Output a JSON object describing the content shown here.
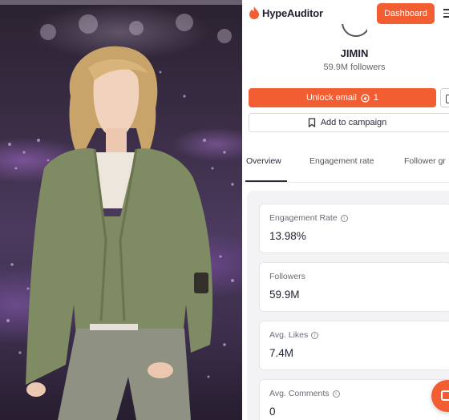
{
  "app": {
    "brand": "HypeAuditor",
    "dashboard_label": "Dashboard"
  },
  "profile": {
    "name": "JIMIN",
    "followers_text": "59.9M followers"
  },
  "actions": {
    "unlock_email_label": "Unlock email",
    "unlock_email_cost": "1",
    "add_to_campaign_label": "Add to campaign"
  },
  "tabs": [
    {
      "label": "Overview",
      "active": true
    },
    {
      "label": "Engagement rate",
      "active": false
    },
    {
      "label": "Follower gr",
      "active": false
    }
  ],
  "metrics": [
    {
      "label": "Engagement Rate",
      "value": "13.98%"
    },
    {
      "label": "Followers",
      "value": "59.9M"
    },
    {
      "label": "Avg. Likes",
      "value": "7.4M"
    },
    {
      "label": "Avg. Comments",
      "value": "0"
    }
  ],
  "colors": {
    "accent": "#f25d32",
    "text_dark": "#1f2130",
    "panel_bg": "#f3f3f6"
  },
  "icons": [
    "flame-logo-icon",
    "menu-icon",
    "coin-icon",
    "bookmark-icon",
    "info-icon",
    "chat-icon"
  ]
}
